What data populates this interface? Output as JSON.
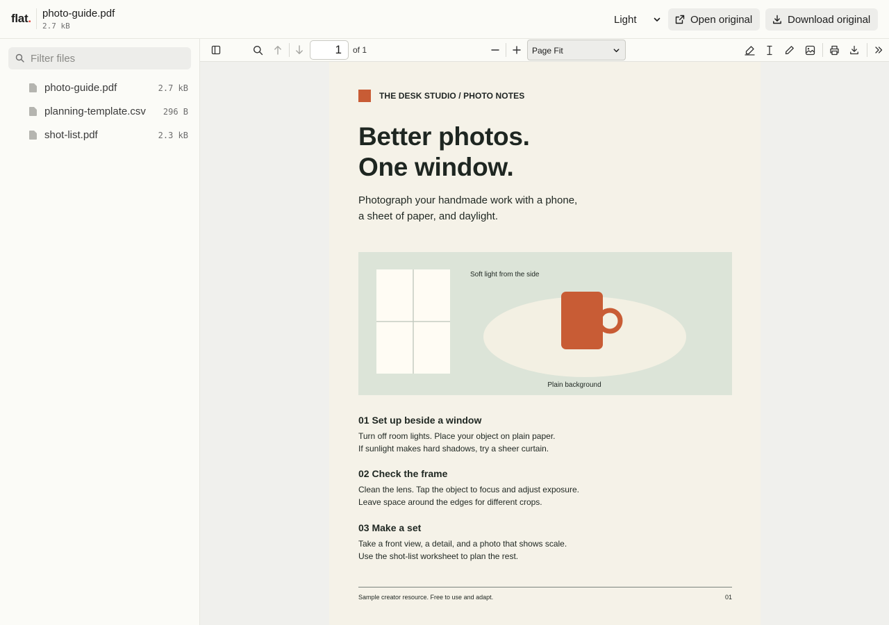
{
  "header": {
    "brand": "flat",
    "brand_dot": ".",
    "file_title": "photo-guide.pdf",
    "file_size": "2.7 kB",
    "theme_label": "Light",
    "open_label": "Open original",
    "download_label": "Download original"
  },
  "sidebar": {
    "filter_placeholder": "Filter files",
    "files": [
      {
        "name": "photo-guide.pdf",
        "size": "2.7 kB"
      },
      {
        "name": "planning-template.csv",
        "size": "296 B"
      },
      {
        "name": "shot-list.pdf",
        "size": "2.3 kB"
      }
    ]
  },
  "toolbar": {
    "page_number": "1",
    "page_of": "of 1",
    "zoom_label": "Page Fit"
  },
  "document": {
    "brand_line": "THE DESK STUDIO / PHOTO NOTES",
    "title_line1": "Better photos.",
    "title_line2": "One window.",
    "subtitle_line1": "Photograph your handmade work with a phone,",
    "subtitle_line2": "a sheet of paper, and daylight.",
    "illustration": {
      "label_light": "Soft light from the side",
      "label_background": "Plain background"
    },
    "steps": [
      {
        "heading": "01  Set up beside a window",
        "line1": "Turn off room lights. Place your object on plain paper.",
        "line2": "If sunlight makes hard shadows, try a sheer curtain."
      },
      {
        "heading": "02  Check the frame",
        "line1": "Clean the lens. Tap the object to focus and adjust exposure.",
        "line2": "Leave space around the edges for different crops."
      },
      {
        "heading": "03  Make a set",
        "line1": "Take a front view, a detail, and a photo that shows scale.",
        "line2": "Use the shot-list worksheet to plan the rest."
      }
    ],
    "footer_text": "Sample creator resource. Free to use and adapt.",
    "page_num": "01"
  },
  "colors": {
    "accent": "#c85c35",
    "page_background": "#f5f2e8",
    "illustration_background": "#dce4d8"
  }
}
